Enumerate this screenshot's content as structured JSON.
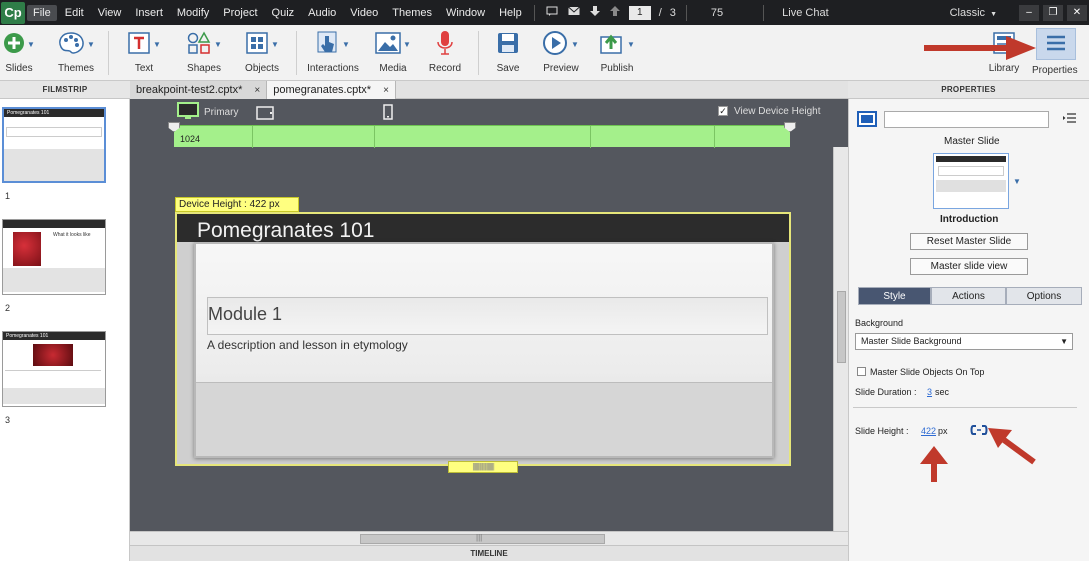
{
  "app": {
    "logo": "Cp"
  },
  "menu": [
    "File",
    "Edit",
    "View",
    "Insert",
    "Modify",
    "Project",
    "Quiz",
    "Audio",
    "Video",
    "Themes",
    "Window",
    "Help"
  ],
  "menubar": {
    "current_page": "1",
    "page_sep": "/",
    "total_pages": "3",
    "zoom": "75",
    "live_chat": "Live Chat",
    "workspace": "Classic"
  },
  "toolbar": {
    "slides": "Slides",
    "themes": "Themes",
    "text": "Text",
    "shapes": "Shapes",
    "objects": "Objects",
    "interactions": "Interactions",
    "media": "Media",
    "record": "Record",
    "save": "Save",
    "preview": "Preview",
    "publish": "Publish",
    "library": "Library",
    "properties": "Properties"
  },
  "filmstrip": {
    "header": "FILMSTRIP",
    "slides": [
      {
        "num": "1",
        "title": "Pomegranates 101"
      },
      {
        "num": "2",
        "title": "What it looks like"
      },
      {
        "num": "3",
        "title": "Pomegranates 101"
      }
    ]
  },
  "tabs": [
    {
      "label": "breakpoint-test2.cptx*",
      "close": "×"
    },
    {
      "label": "pomegranates.cptx*",
      "close": "×"
    }
  ],
  "stage": {
    "primary_label": "Primary",
    "view_device_height": "View Device Height",
    "bp_width": "1024",
    "device_height_label": "Device Height : 422 px",
    "slide_title": "Pomegranates 101",
    "module_title": "Module 1",
    "module_desc": "A description and lesson in etymology",
    "handle_grip": "||||||||||||||||||||",
    "hscroll_grip": "|||"
  },
  "timeline": {
    "header": "TIMELINE"
  },
  "properties": {
    "header": "PROPERTIES",
    "master_slide_label": "Master Slide",
    "master_name": "Introduction",
    "reset_button": "Reset Master Slide",
    "view_button": "Master slide view",
    "tabs": [
      "Style",
      "Actions",
      "Options"
    ],
    "background_label": "Background",
    "background_value": "Master Slide Background",
    "objects_on_top": "Master Slide Objects On Top",
    "slide_duration_label": "Slide Duration :",
    "slide_duration_value": "3",
    "slide_duration_unit": "sec",
    "slide_height_label": "Slide Height :",
    "slide_height_value": "422",
    "slide_height_unit": "px"
  },
  "colors": {
    "accent_green": "#a4f08b",
    "device_yellow": "#ffff80",
    "arrow_red": "#c0392b",
    "tab_active": "#485671"
  }
}
